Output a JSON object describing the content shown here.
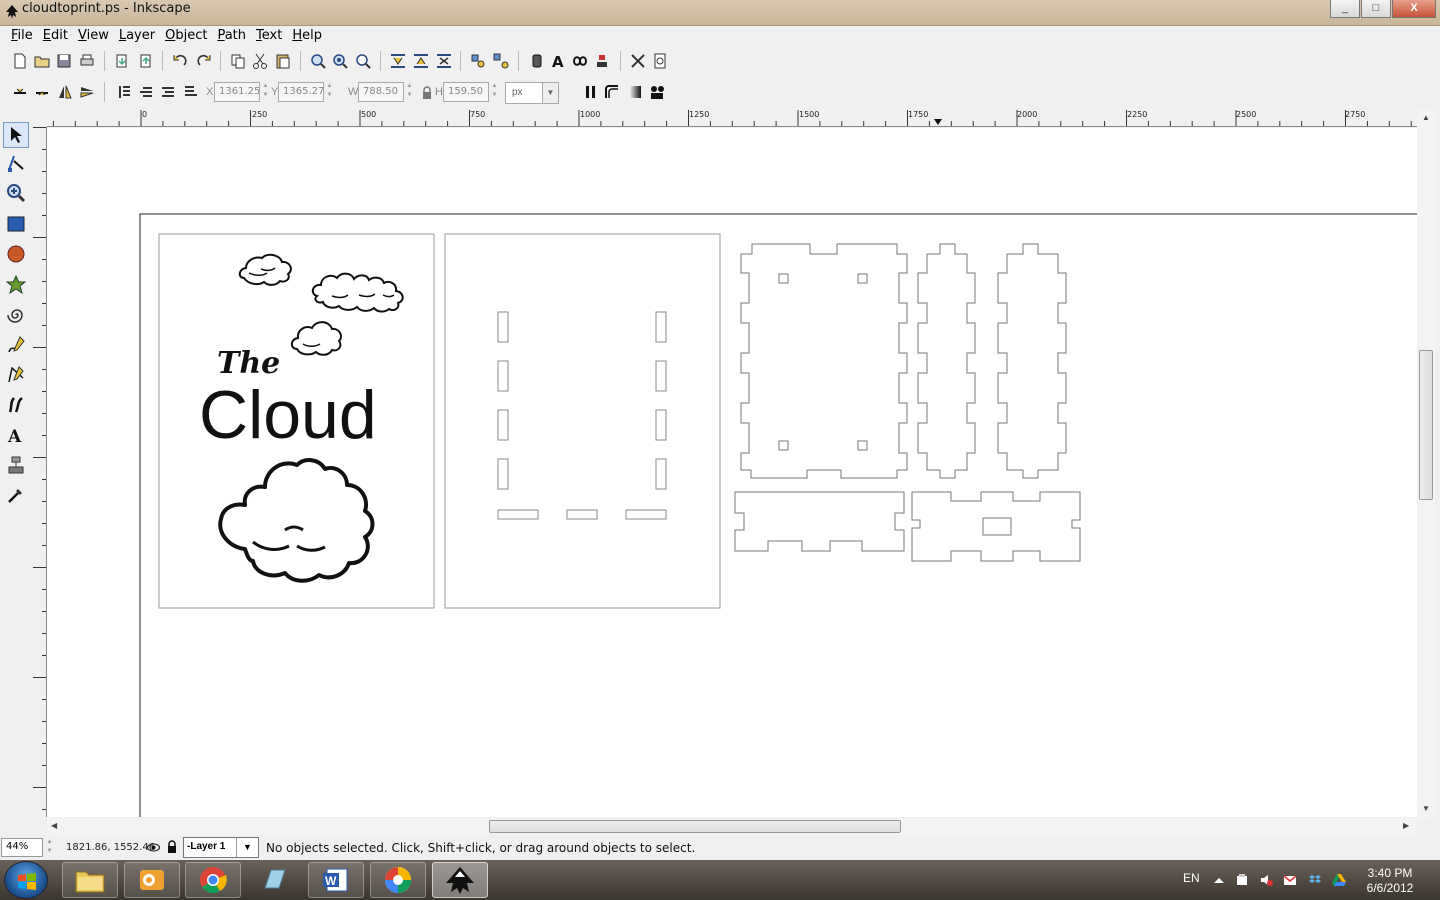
{
  "window": {
    "title": "cloudtoprint.ps - Inkscape",
    "min": "_",
    "max": "□",
    "close": "X"
  },
  "menu": [
    {
      "key": "F",
      "rest": "ile"
    },
    {
      "key": "E",
      "rest": "dit"
    },
    {
      "key": "V",
      "rest": "iew"
    },
    {
      "key": "L",
      "rest": "ayer"
    },
    {
      "key": "O",
      "rest": "bject"
    },
    {
      "key": "P",
      "rest": "ath"
    },
    {
      "key": "T",
      "rest": "ext"
    },
    {
      "key": "H",
      "rest": "elp"
    }
  ],
  "controls": {
    "x_label": "X",
    "x_value": "1361.25",
    "y_label": "Y",
    "y_value": "1365.27",
    "w_label": "W",
    "w_value": "788.50",
    "h_label": "H",
    "h_value": "159.50",
    "unit": "px"
  },
  "ruler": {
    "labels": [
      "0",
      "250",
      "500",
      "750",
      "1000",
      "1250",
      "1500",
      "1750",
      "2000",
      "2250",
      "2500",
      "2750"
    ]
  },
  "canvas": {
    "text_the": "The",
    "text_cloud": "Cloud"
  },
  "status": {
    "zoom": "44%",
    "coords": "1821.86, 1552.46",
    "layer": "-Layer 1",
    "message": "No objects selected. Click, Shift+click, or drag around objects to select."
  },
  "taskbar": {
    "language": "EN",
    "time": "3:40 PM",
    "date": "6/6/2012"
  },
  "colors": {
    "accent": "#3b6fb0",
    "canvas": "#ffffff",
    "chrome": "#f0f0f0"
  }
}
